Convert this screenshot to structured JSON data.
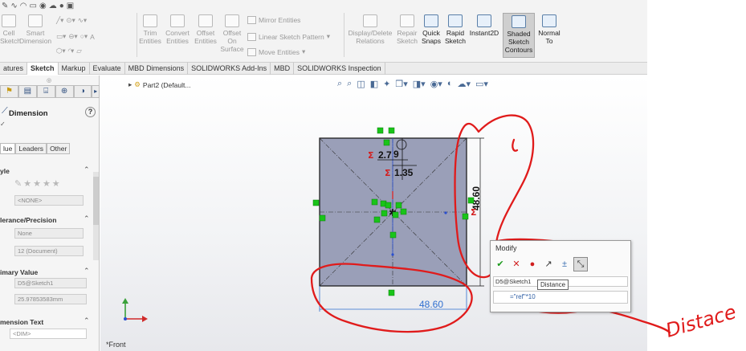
{
  "ribbon": {
    "buttons": {
      "cell_line1": "Cell",
      "cell_line2": "Sketch",
      "smart_line1": "Smart",
      "smart_line2": "Dimension",
      "trim_line1": "Trim",
      "trim_line2": "Entities",
      "convert_line1": "Convert",
      "convert_line2": "Entities",
      "offset_line1": "Offset",
      "offset_line2": "Entities",
      "offset_on_line1": "Offset",
      "offset_on_line2": "On",
      "offset_on_line3": "Surface",
      "display_line1": "Display/Delete",
      "display_line2": "Relations",
      "repair_line1": "Repair",
      "repair_line2": "Sketch",
      "quick_line1": "Quick",
      "quick_line2": "Snaps",
      "rapid_line1": "Rapid",
      "rapid_line2": "Sketch",
      "instant_line1": "Instant2D",
      "shaded_line1": "Shaded",
      "shaded_line2": "Sketch",
      "shaded_line3": "Contours",
      "normal_line1": "Normal",
      "normal_line2": "To"
    },
    "mirror_entities": "Mirror Entities",
    "linear_pattern": "Linear Sketch Pattern",
    "move_entities": "Move Entities"
  },
  "tabs": [
    "atures",
    "Sketch",
    "Markup",
    "Evaluate",
    "MBD Dimensions",
    "SOLIDWORKS Add-Ins",
    "MBD",
    "SOLIDWORKS Inspection"
  ],
  "property_manager": {
    "title": "Dimension",
    "help": "?",
    "subtabs": [
      "lue",
      "Leaders",
      "Other"
    ],
    "style_section": "yle",
    "style_value": "<NONE>",
    "tolerance_section": "lerance/Precision",
    "tolerance_type": "None",
    "precision": "12 (Document)",
    "primary_section": "imary Value",
    "primary_name": "D5@Sketch1",
    "primary_value": "25.97853583mm",
    "dimtext_section": "mension Text",
    "dimtext_value": "<DIM>"
  },
  "viewport": {
    "tree_item": "Part2 (Default...",
    "view_label": "*Front"
  },
  "dimensions": {
    "top_first": "2.7",
    "top_second": "9",
    "small": "1.35",
    "vertical": "48.60",
    "horizontal": "48.60"
  },
  "modify": {
    "title": "Modify",
    "dim_name": "D5@Sketch1",
    "value": "=\"ref\"*10",
    "tooltip": "Distance"
  },
  "annotation": {
    "text": "Distace",
    "color": "#e01b1b"
  },
  "colors": {
    "accent": "#2f6fd0",
    "relation_green": "#19c419",
    "ink": "#e01b1b"
  }
}
